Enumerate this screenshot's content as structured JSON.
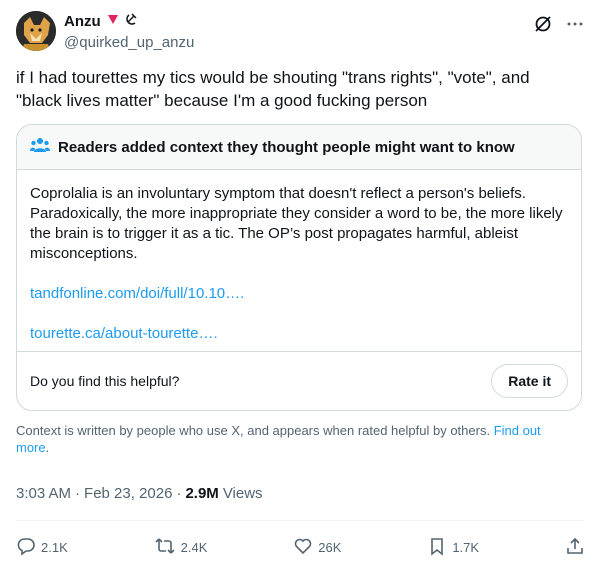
{
  "header": {
    "display_name": "Anzu",
    "handle": "@quirked_up_anzu",
    "avatar_icon": "fox-avatar-icon",
    "badge_icons": [
      "red-triangle-icon",
      "hammer-sickle-icon"
    ],
    "actions": [
      "grok-icon",
      "more-icon"
    ]
  },
  "tweet": {
    "text": "if I had tourettes my tics would be shouting \"trans rights\", \"vote\", and \"black lives matter\" because I'm a good fucking person"
  },
  "community_note": {
    "icon": "people-icon",
    "title": "Readers added context they thought people might want to know",
    "body": "Coprolalia is an involuntary symptom that doesn't reflect a person's beliefs. Paradoxically, the more inappropriate they consider a word to be, the more likely the brain is to trigger it as a tic. The OP’s post propagates harmful, ableist misconceptions.",
    "links": [
      "tandfonline.com/doi/full/10.10….",
      "tourette.ca/about-tourette…."
    ],
    "helpful_question": "Do you find this helpful?",
    "rate_label": "Rate it"
  },
  "context": {
    "text": "Context is written by people who use X, and appears when rated helpful by others.",
    "link_text": "Find out more",
    "trailing": "."
  },
  "meta": {
    "time": "3:03 AM",
    "sep1": "·",
    "date": "Feb 23, 2026",
    "sep2": "·",
    "views_count": "2.9M",
    "views_label": "Views"
  },
  "actions": {
    "replies": "2.1K",
    "reposts": "2.4K",
    "likes": "26K",
    "bookmarks": "1.7K"
  },
  "colors": {
    "accent": "#1d9bf0",
    "text": "#0f1419",
    "muted": "#536471",
    "border": "#cfd9de"
  }
}
